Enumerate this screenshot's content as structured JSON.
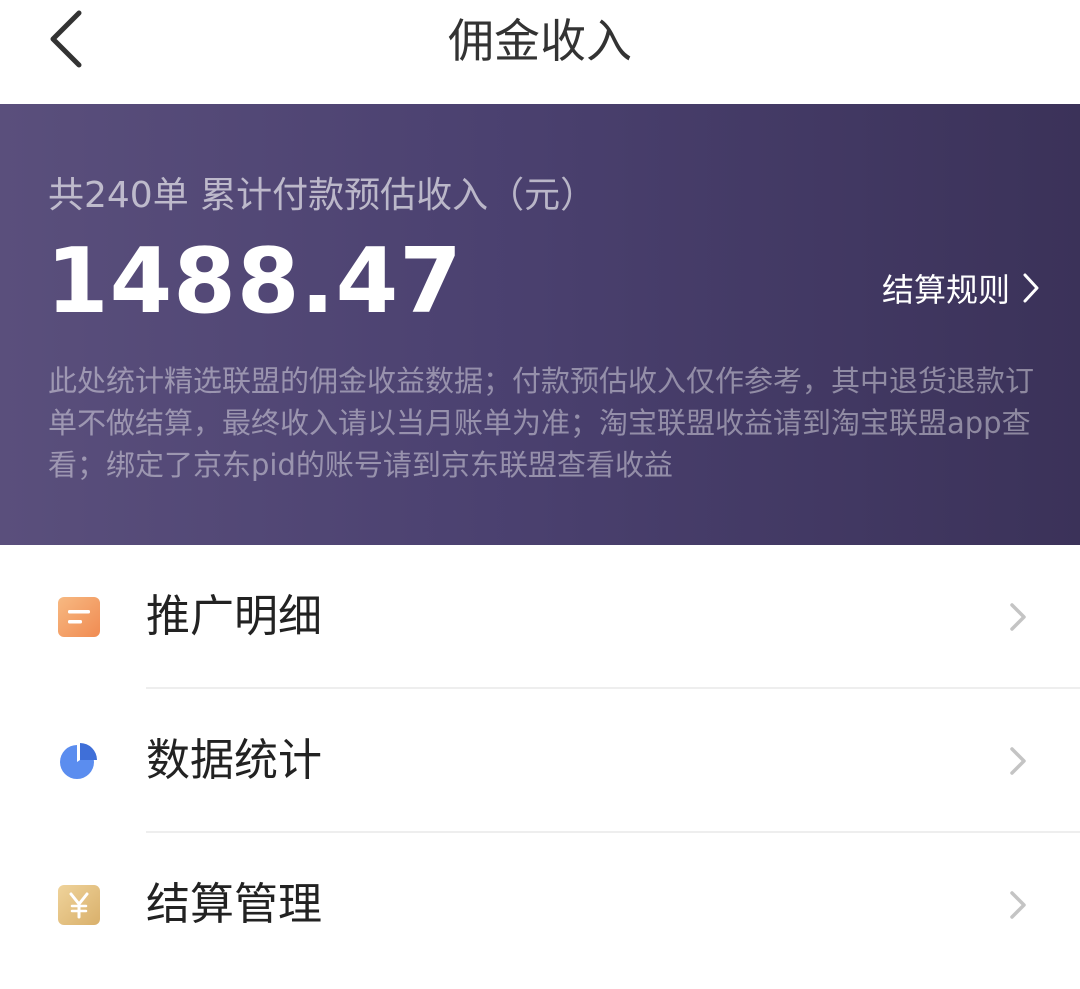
{
  "header": {
    "title": "佣金收入"
  },
  "banner": {
    "summary": "共240单 累计付款预估收入（元）",
    "amount": "1488.47",
    "rules_label": "结算规则",
    "note": "此处统计精选联盟的佣金收益数据；付款预估收入仅作参考，其中退货退款订单不做结算，最终收入请以当月账单为准；淘宝联盟收益请到淘宝联盟app查看；绑定了京东pid的账号请到京东联盟查看收益"
  },
  "menu": {
    "items": [
      {
        "label": "推广明细",
        "icon": "document-icon"
      },
      {
        "label": "数据统计",
        "icon": "pie-chart-icon"
      },
      {
        "label": "结算管理",
        "icon": "yen-icon"
      }
    ]
  },
  "colors": {
    "banner_start": "#5a4f7c",
    "banner_end": "#3b3259",
    "icon_orange": "#f4a468",
    "icon_blue": "#5b8def",
    "icon_gold": "#e4c382"
  }
}
